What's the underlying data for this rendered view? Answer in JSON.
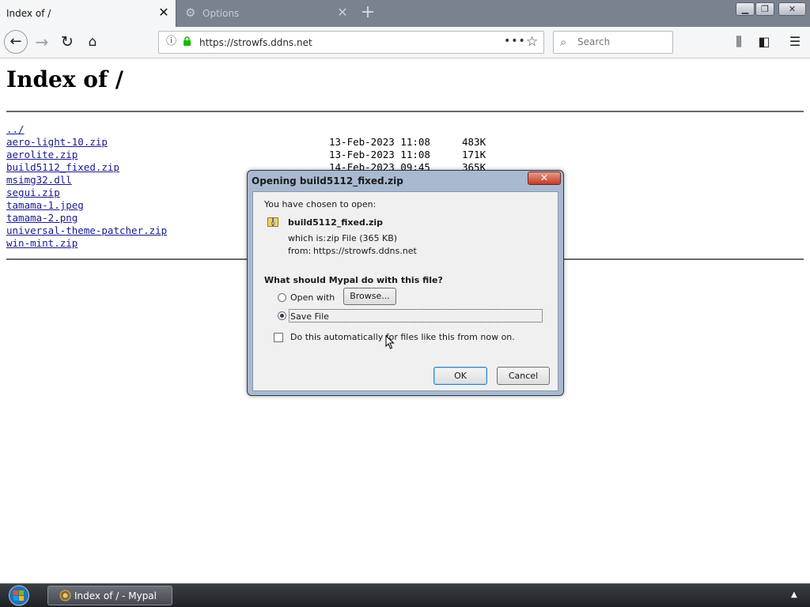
{
  "browser": {
    "tabs": [
      {
        "label": "Index of /",
        "active": true
      },
      {
        "label": "Options",
        "active": false
      }
    ],
    "new_tab_icon": "+",
    "window_controls": {
      "minimize": "▁",
      "maximize": "❐",
      "close": "✕"
    },
    "url": "https://strowfs.ddns.net",
    "search_placeholder": "Search"
  },
  "page": {
    "title": "Index of /",
    "entries": [
      {
        "name": "../",
        "date": "",
        "size": ""
      },
      {
        "name": "aero-light-10.zip",
        "date": "13-Feb-2023 11:08",
        "size": "483K"
      },
      {
        "name": "aerolite.zip",
        "date": "13-Feb-2023 11:08",
        "size": "171K"
      },
      {
        "name": "build5112_fixed.zip",
        "date": "14-Feb-2023 09:45",
        "size": "365K"
      },
      {
        "name": "msimg32.dll",
        "date": "",
        "size": ""
      },
      {
        "name": "segui.zip",
        "date": "",
        "size": ""
      },
      {
        "name": "tamama-1.jpeg",
        "date": "",
        "size": ""
      },
      {
        "name": "tamama-2.png",
        "date": "",
        "size": ""
      },
      {
        "name": "universal-theme-patcher.zip",
        "date": "",
        "size": ""
      },
      {
        "name": "win-mint.zip",
        "date": "",
        "size": ""
      }
    ]
  },
  "dialog": {
    "title": "Opening build5112_fixed.zip",
    "close_label": "✕",
    "intro": "You have chosen to open:",
    "filename": "build5112_fixed.zip",
    "which_is_label": "which is:",
    "which_is_value": "zip File (365 KB)",
    "from_label": "from:",
    "from_value": "https://strowfs.ddns.net",
    "question": "What should Mypal do with this file?",
    "open_with_label": "Open with",
    "browse_label": "Browse...",
    "save_file_label": "Save File",
    "auto_label": "Do this automatically for files like this from now on.",
    "ok_label": "OK",
    "cancel_label": "Cancel",
    "selected_option": "save_file",
    "auto_checked": false
  },
  "taskbar": {
    "task_label": "Index of / - Mypal",
    "tray_arrow": "▲"
  }
}
